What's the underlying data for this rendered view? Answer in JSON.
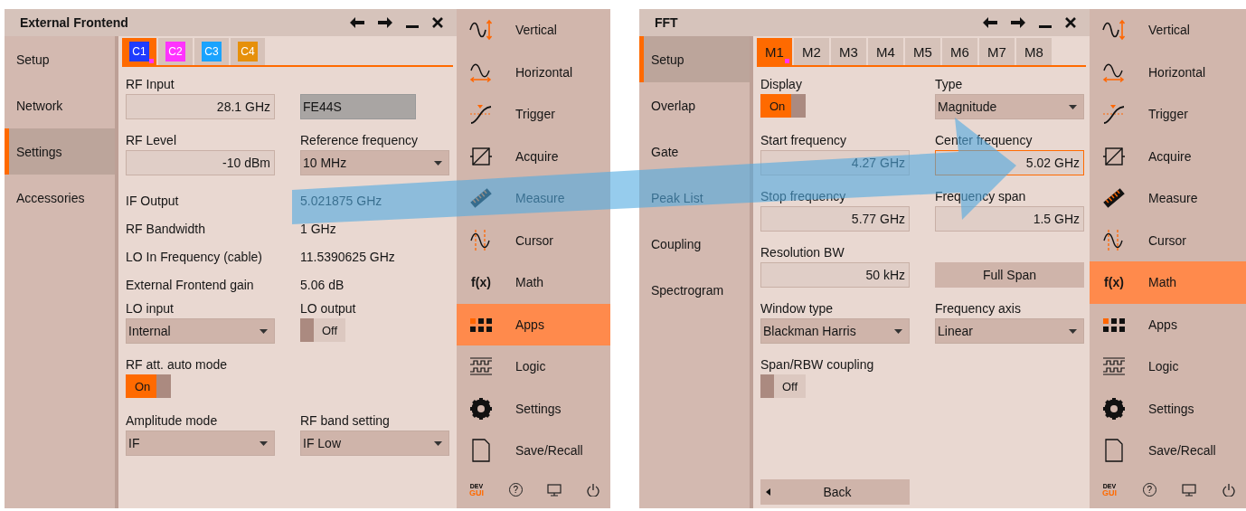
{
  "panels": [
    {
      "window": {
        "title": "External Frontend",
        "side_tabs": [
          {
            "label": "Setup",
            "selected": false
          },
          {
            "label": "Network",
            "selected": false
          },
          {
            "label": "Settings",
            "selected": true
          },
          {
            "label": "Accessories",
            "selected": false
          }
        ],
        "tabs": [
          {
            "label": "C1",
            "selected": true,
            "color": "#1f3cff"
          },
          {
            "label": "C2",
            "selected": false,
            "color": "#ff33ff"
          },
          {
            "label": "C3",
            "selected": false,
            "color": "#1aa3ff"
          },
          {
            "label": "C4",
            "selected": false,
            "color": "#e6900a"
          }
        ],
        "rows": [
          {
            "kind": "fields",
            "cells": [
              {
                "label": "RF Input",
                "control": {
                  "kind": "input",
                  "value": "28.1 GHz",
                  "focused": false
                }
              },
              {
                "control": {
                  "kind": "readonly",
                  "value": "FE44S"
                }
              }
            ]
          },
          {
            "kind": "fields",
            "cells": [
              {
                "label": "RF Level",
                "control": {
                  "kind": "input",
                  "value": "-10 dBm",
                  "focused": false
                }
              },
              {
                "label": "Reference frequency",
                "control": {
                  "kind": "dropdown",
                  "value": "10 MHz"
                }
              }
            ]
          },
          {
            "kind": "info",
            "label": "IF Output",
            "value": "5.021875 GHz"
          },
          {
            "kind": "info",
            "label": "RF Bandwidth",
            "value": "1 GHz"
          },
          {
            "kind": "info",
            "label": "LO In Frequency (cable)",
            "value": "11.5390625 GHz"
          },
          {
            "kind": "info",
            "label": "External Frontend gain",
            "value": "5.06 dB"
          },
          {
            "kind": "fields",
            "cells": [
              {
                "label": "LO input",
                "control": {
                  "kind": "dropdown",
                  "value": "Internal"
                }
              },
              {
                "label": "LO output",
                "control": {
                  "kind": "toggle",
                  "on": false,
                  "text": "Off"
                }
              }
            ]
          },
          {
            "kind": "fields",
            "cells": [
              {
                "label": "RF att. auto mode",
                "control": {
                  "kind": "toggle",
                  "on": true,
                  "text": "On"
                }
              }
            ]
          },
          {
            "kind": "fields",
            "cells": [
              {
                "label": "Amplitude mode",
                "control": {
                  "kind": "dropdown",
                  "value": "IF"
                }
              },
              {
                "label": "RF band setting",
                "control": {
                  "kind": "dropdown",
                  "value": "IF Low"
                }
              }
            ]
          }
        ]
      },
      "menu": {
        "items": [
          {
            "label": "Vertical",
            "selected": false
          },
          {
            "label": "Horizontal",
            "selected": false
          },
          {
            "label": "Trigger",
            "selected": false
          },
          {
            "label": "Acquire",
            "selected": false
          },
          {
            "label": "Measure",
            "selected": false
          },
          {
            "label": "Cursor",
            "selected": false
          },
          {
            "label": "Math",
            "icon_text": "f(x)",
            "selected": false
          },
          {
            "label": "Apps",
            "selected": true
          },
          {
            "label": "Logic",
            "selected": false
          },
          {
            "label": "Settings",
            "selected": false
          },
          {
            "label": "Save/Recall",
            "selected": false
          }
        ],
        "footer": {
          "dev": "DEV",
          "gui": "GUI",
          "help": "?"
        }
      }
    },
    {
      "window": {
        "title": "FFT",
        "side_tabs": [
          {
            "label": "Setup",
            "selected": true
          },
          {
            "label": "Overlap",
            "selected": false
          },
          {
            "label": "Gate",
            "selected": false
          },
          {
            "label": "Peak List",
            "selected": false
          },
          {
            "label": "Coupling",
            "selected": false
          },
          {
            "label": "Spectrogram",
            "selected": false
          }
        ],
        "tabs": [
          {
            "label": "M1",
            "selected": true
          },
          {
            "label": "M2",
            "selected": false
          },
          {
            "label": "M3",
            "selected": false
          },
          {
            "label": "M4",
            "selected": false
          },
          {
            "label": "M5",
            "selected": false
          },
          {
            "label": "M6",
            "selected": false
          },
          {
            "label": "M7",
            "selected": false
          },
          {
            "label": "M8",
            "selected": false
          }
        ],
        "rows": [
          {
            "kind": "fields",
            "cells": [
              {
                "label": "Display",
                "control": {
                  "kind": "toggle",
                  "on": true,
                  "text": "On"
                }
              },
              {
                "label": "Type",
                "control": {
                  "kind": "dropdown",
                  "value": "Magnitude"
                }
              }
            ]
          },
          {
            "kind": "fields",
            "cells": [
              {
                "label": "Start frequency",
                "control": {
                  "kind": "input",
                  "value": "4.27 GHz",
                  "focused": false
                }
              },
              {
                "label": "Center frequency",
                "control": {
                  "kind": "input",
                  "value": "5.02 GHz",
                  "focused": true
                }
              }
            ]
          },
          {
            "kind": "fields",
            "cells": [
              {
                "label": "Stop frequency",
                "control": {
                  "kind": "input",
                  "value": "5.77 GHz",
                  "focused": false
                }
              },
              {
                "label": "Frequency span",
                "control": {
                  "kind": "input",
                  "value": "1.5 GHz",
                  "focused": false
                }
              }
            ]
          },
          {
            "kind": "fields",
            "cells": [
              {
                "label": "Resolution BW",
                "control": {
                  "kind": "input",
                  "value": "50 kHz",
                  "focused": false
                }
              },
              {
                "control": {
                  "kind": "button",
                  "value": "Full Span"
                }
              }
            ]
          },
          {
            "kind": "fields",
            "cells": [
              {
                "label": "Window type",
                "control": {
                  "kind": "dropdown",
                  "value": "Blackman Harris"
                }
              },
              {
                "label": "Frequency axis",
                "control": {
                  "kind": "dropdown",
                  "value": "Linear"
                }
              }
            ]
          },
          {
            "kind": "fields",
            "cells": [
              {
                "label": "Span/RBW coupling",
                "control": {
                  "kind": "toggle",
                  "on": false,
                  "text": "Off"
                }
              }
            ]
          }
        ],
        "back_button": "Back"
      },
      "menu": {
        "items": [
          {
            "label": "Vertical",
            "selected": false
          },
          {
            "label": "Horizontal",
            "selected": false
          },
          {
            "label": "Trigger",
            "selected": false
          },
          {
            "label": "Acquire",
            "selected": false
          },
          {
            "label": "Measure",
            "selected": false
          },
          {
            "label": "Cursor",
            "selected": false
          },
          {
            "label": "Math",
            "icon_text": "f(x)",
            "selected": true
          },
          {
            "label": "Apps",
            "selected": false
          },
          {
            "label": "Logic",
            "selected": false
          },
          {
            "label": "Settings",
            "selected": false
          },
          {
            "label": "Save/Recall",
            "selected": false
          }
        ],
        "footer": {
          "dev": "DEV",
          "gui": "GUI",
          "help": "?"
        }
      }
    }
  ]
}
